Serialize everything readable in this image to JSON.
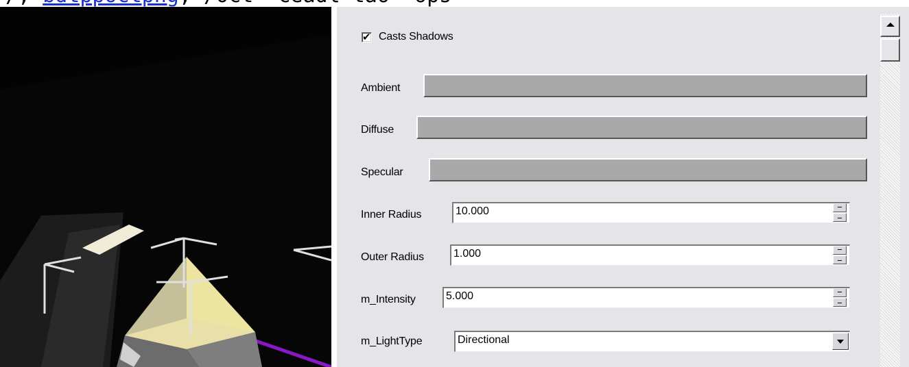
{
  "header_text": {
    "before": "/,",
    "link": "bdtppoctpng",
    "after": "/Oct  ceadl tao  ops"
  },
  "viewport": {
    "background": "#030303",
    "gizmo_color": "#e0e0e0",
    "light_color": "#f0ecd8",
    "pyramid_light": "#ece4a0",
    "pyramid_dark": "#7a7a7a",
    "beam_color": "#8a18c8"
  },
  "properties": {
    "casts_shadows": {
      "label": "Casts Shadows",
      "checked": true,
      "check_glyph": "✔"
    },
    "ambient": {
      "label": "Ambient",
      "color": "#a9a9a9"
    },
    "diffuse": {
      "label": "Diffuse",
      "color": "#a9a9a9"
    },
    "specular": {
      "label": "Specular",
      "color": "#a9a9a9"
    },
    "inner_radius": {
      "label": "Inner Radius",
      "value": "10.000"
    },
    "outer_radius": {
      "label": "Outer Radius",
      "value": "1.000"
    },
    "intensity": {
      "label": "m_Intensity",
      "value": "5.000"
    },
    "light_type": {
      "label": "m_LightType",
      "value": "Directional"
    }
  },
  "scrollbar": {
    "icon_up": "arrow-up-icon"
  }
}
